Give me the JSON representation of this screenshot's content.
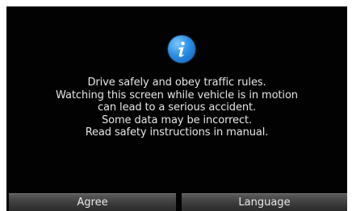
{
  "dialog": {
    "icon": "info-icon",
    "lines": [
      "Drive safely and obey traffic rules.",
      "Watching this screen while vehicle is in motion",
      "can lead to a serious accident.",
      "Some data may be incorrect.",
      "Read safety instructions in manual."
    ]
  },
  "buttons": {
    "agree_label": "Agree",
    "language_label": "Language"
  },
  "colors": {
    "background": "#020202",
    "text": "#e6e6e6",
    "icon_blue": "#2b8fe6",
    "button": "#3e3e3e"
  }
}
